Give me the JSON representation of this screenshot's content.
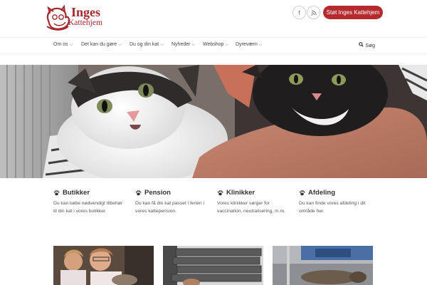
{
  "header": {
    "brand_line1": "Inges",
    "brand_line2": "Kattehjem",
    "social": [
      {
        "icon": "facebook-icon",
        "glyph": "f"
      },
      {
        "icon": "rss-icon",
        "glyph": ")"
      }
    ],
    "cta_label": "Støt Inges Kattehjem"
  },
  "nav": {
    "items": [
      {
        "label": "Om os"
      },
      {
        "label": "Det kan du gøre"
      },
      {
        "label": "Du og din kat"
      },
      {
        "label": "Nyheder"
      },
      {
        "label": "Webshop"
      },
      {
        "label": "Dyreværn"
      }
    ],
    "search_label": "Søg"
  },
  "features": [
    {
      "title": "Butikker",
      "desc": "Du kan købe nødvendigt tilbehør til din kat i vores butikker."
    },
    {
      "title": "Pension",
      "desc": "Du kan få din kat passet i ferien i vores kattepension."
    },
    {
      "title": "Klinikker",
      "desc": "Vores klinikker sørger for vaccination, neutralisering, m.m."
    },
    {
      "title": "Afdeling",
      "desc": "Du kan finde vores afdeling i dit område her."
    }
  ],
  "colors": {
    "brand": "#b52a2f",
    "logo": "#a5282d"
  }
}
